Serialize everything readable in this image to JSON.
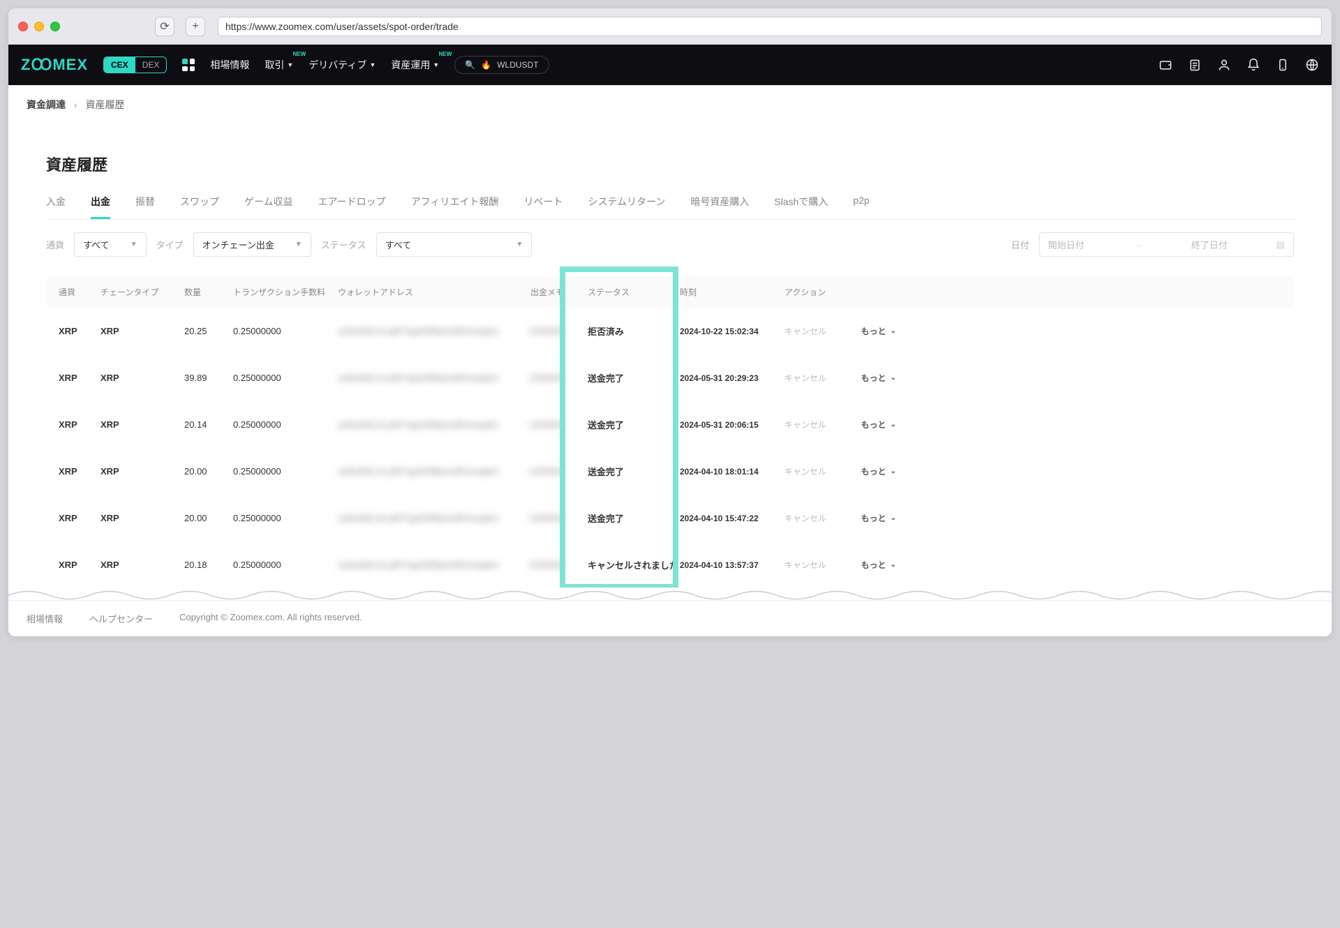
{
  "browser": {
    "url": "https://www.zoomex.com/user/assets/spot-order/trade"
  },
  "topnav": {
    "logo": "ZꝎMEX",
    "cex": "CEX",
    "dex": "DEX",
    "items": [
      "相場情報",
      "取引",
      "デリバティブ",
      "資産運用"
    ],
    "badge": "NEW",
    "search": "WLDUSDT"
  },
  "breadcrumb": {
    "a": "資金調達",
    "b": "資産履歴"
  },
  "title": "資産履歴",
  "tabs": [
    "入金",
    "出金",
    "振替",
    "スワップ",
    "ゲーム収益",
    "エアードロップ",
    "アフィリエイト報酬",
    "リベート",
    "システムリターン",
    "暗号資産購入",
    "Slashで購入",
    "p2p"
  ],
  "active_tab": 1,
  "filters": {
    "currency_label": "通貨",
    "currency_val": "すべて",
    "type_label": "タイプ",
    "type_val": "オンチェーン出金",
    "status_label": "ステータス",
    "status_val": "すべて",
    "date_label": "日付",
    "date_start": "開始日付",
    "date_end": "終了日付"
  },
  "columns": {
    "currency": "通貨",
    "chain": "チェーンタイプ",
    "qty": "数量",
    "fee": "トランザクション手数料",
    "addr": "ウォレットアドレス",
    "memo": "出金メモ",
    "status": "ステータス",
    "time": "時刻",
    "action": "アクション"
  },
  "rows": [
    {
      "currency": "XRP",
      "chain": "XRP",
      "qty": "20.25",
      "fee": "0.25000000",
      "status": "拒否済み",
      "time": "2024-10-22 15:02:34"
    },
    {
      "currency": "XRP",
      "chain": "XRP",
      "qty": "39.89",
      "fee": "0.25000000",
      "status": "送金完了",
      "time": "2024-05-31 20:29:23"
    },
    {
      "currency": "XRP",
      "chain": "XRP",
      "qty": "20.14",
      "fee": "0.25000000",
      "status": "送金完了",
      "time": "2024-05-31 20:06:15"
    },
    {
      "currency": "XRP",
      "chain": "XRP",
      "qty": "20.00",
      "fee": "0.25000000",
      "status": "送金完了",
      "time": "2024-04-10 18:01:14"
    },
    {
      "currency": "XRP",
      "chain": "XRP",
      "qty": "20.00",
      "fee": "0.25000000",
      "status": "送金完了",
      "time": "2024-04-10 15:47:22"
    },
    {
      "currency": "XRP",
      "chain": "XRP",
      "qty": "20.18",
      "fee": "0.25000000",
      "status": "キャンセルされました",
      "time": "2024-04-10 13:57:37"
    }
  ],
  "row_actions": {
    "cancel": "キャンセル",
    "more": "もっと"
  },
  "footer": {
    "a": "相場情報",
    "b": "ヘルプセンター",
    "c": "Copyright © Zoomex.com. All rights reserved."
  }
}
